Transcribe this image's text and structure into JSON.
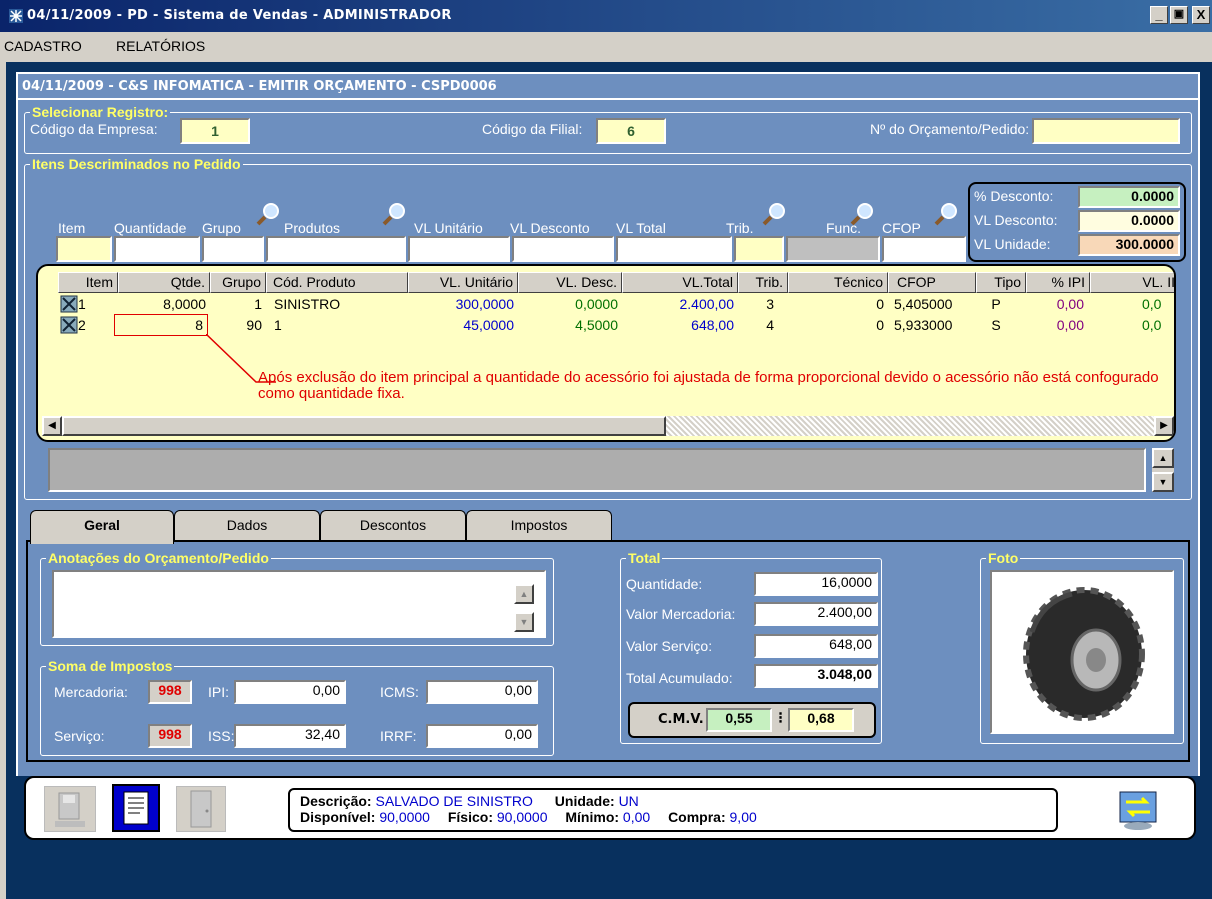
{
  "window": {
    "title": "04/11/2009 - PD - Sistema de Vendas - ADMINISTRADOR",
    "min": "_",
    "max": "🗗",
    "close": "X"
  },
  "menu": [
    "CADASTRO",
    "RELATÓRIOS"
  ],
  "form": {
    "title": "04/11/2009 - C&S INFOMATICA - EMITIR ORÇAMENTO - CSPD0006"
  },
  "selecionar": {
    "label": "Selecionar Registro:",
    "empresa_label": "Código da Empresa:",
    "empresa": "1",
    "filial_label": "Código da Filial:",
    "filial": "6",
    "orcamento_label": "Nº do Orçamento/Pedido:",
    "orcamento": ""
  },
  "itens": {
    "label": "Itens Descriminados no Pedido",
    "fields": {
      "item": "Item",
      "quantidade": "Quantidade",
      "grupo": "Grupo",
      "produtos": "Produtos",
      "vl_unitario": "VL Unitário",
      "vl_desconto": "VL Desconto",
      "vl_total": "VL Total",
      "trib": "Trib.",
      "func": "Func.",
      "cfop": "CFOP"
    },
    "desc": {
      "pct_label": "% Desconto:",
      "pct": "0.0000",
      "vl_label": "VL Desconto:",
      "vl": "0.0000",
      "uni_label": "VL Unidade:",
      "uni": "300.0000"
    }
  },
  "grid": {
    "headers": [
      "Item",
      "Qtde.",
      "Grupo",
      "Cód. Produto",
      "VL. Unitário",
      "VL. Desc.",
      "VL.Total",
      "Trib.",
      "Técnico",
      "CFOP",
      "Tipo",
      "% IPI",
      "VL. II"
    ],
    "rows": [
      [
        "1",
        "8,0000",
        "1",
        "SINISTRO",
        "300,0000",
        "0,0000",
        "2.400,00",
        "3",
        "0",
        "5,405000",
        "P",
        "0,00",
        "0,0"
      ],
      [
        "2",
        "8",
        "90",
        "1",
        "45,0000",
        "4,5000",
        "648,00",
        "4",
        "0",
        "5,933000",
        "S",
        "0,00",
        "0,0"
      ]
    ],
    "note": "Após exclusão do item principal a quantidade do acessório foi ajustada de forma proporcional devido o acessório não está confogurado como quantidade fixa."
  },
  "tabs": [
    "Geral",
    "Dados",
    "Descontos",
    "Impostos"
  ],
  "anotacoes": {
    "label": "Anotações do Orçamento/Pedido",
    "text": ""
  },
  "impostos": {
    "label": "Soma de Impostos",
    "merc_label": "Mercadoria:",
    "merc": "998",
    "ipi_label": "IPI:",
    "ipi": "0,00",
    "icms_label": "ICMS:",
    "icms": "0,00",
    "serv_label": "Serviço:",
    "serv": "998",
    "iss_label": "ISS:",
    "iss": "32,40",
    "irrf_label": "IRRF:",
    "irrf": "0,00"
  },
  "total": {
    "label": "Total",
    "qtd_label": "Quantidade:",
    "qtd": "16,0000",
    "merc_label": "Valor Mercadoria:",
    "merc": "2.400,00",
    "serv_label": "Valor Serviço:",
    "serv": "648,00",
    "acum_label": "Total Acumulado:",
    "acum": "3.048,00",
    "cmv_label": "C.M.V.",
    "cmv1": "0,55",
    "cmv2": "0,68"
  },
  "foto": {
    "label": "Foto"
  },
  "status": {
    "descricao_label": "Descrição:",
    "descricao": "SALVADO DE SINISTRO",
    "unidade_label": "Unidade:",
    "unidade": "UN",
    "disponivel_label": "Disponível:",
    "disponivel": "90,0000",
    "fisico_label": "Físico:",
    "fisico": "90,0000",
    "minimo_label": "Mínimo:",
    "minimo": "0,00",
    "compra_label": "Compra:",
    "compra": "9,00"
  }
}
